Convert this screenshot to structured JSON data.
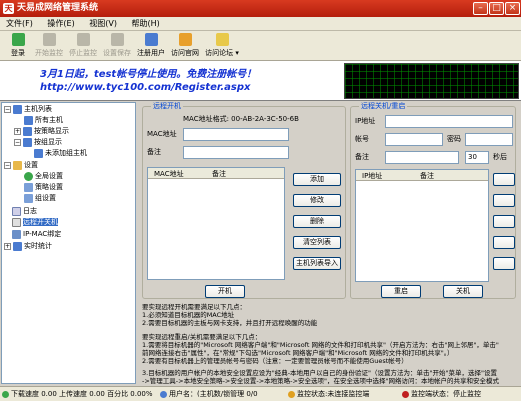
{
  "window": {
    "title": "天易成网络管理系统"
  },
  "menu": [
    {
      "label": "文件(F)"
    },
    {
      "label": "操作(E)"
    },
    {
      "label": "视图(V)"
    },
    {
      "label": "帮助(H)"
    }
  ],
  "toolbar": {
    "login": "登录",
    "start_monitor": "开始监控",
    "stop_monitor": "停止监控",
    "save_settings": "设置保存",
    "register": "注册用户",
    "official_site": "访问官网",
    "forum": "访问论坛"
  },
  "banner": {
    "line1": "3月1日起，test帐号停止使用。免费注册帐号！",
    "line2": "http://www.tyc100.com/Register.aspx"
  },
  "tree": {
    "host_list": "主机列表",
    "all_hosts": "所有主机",
    "by_policy": "按策略显示",
    "by_group": "按组显示",
    "unassigned": "未添加组主机",
    "settings": "设置",
    "global_settings": "全局设置",
    "policy_settings": "策略设置",
    "group_settings": "组设置",
    "log": "日志",
    "remote_power": "远程开关机",
    "ip_mac": "IP-MAC绑定",
    "realtime": "实时统计"
  },
  "boot": {
    "legend": "远程开机",
    "mac_format": "MAC地址格式: 00-AB-2A-3C-50-6B",
    "mac_label": "MAC地址",
    "note_label": "备注",
    "col_mac": "MAC地址",
    "col_note": "备注",
    "add": "添加",
    "edit": "修改",
    "delete": "删除",
    "clear": "清空列表",
    "import": "主机列表导入",
    "power_on": "开机"
  },
  "shutdown": {
    "legend": "远程关机/重启",
    "ip_label": "IP地址",
    "account_label": "帐号",
    "password_label": "密码",
    "note_label": "备注",
    "delay": "30",
    "seconds": "秒后",
    "col_ip": "IP地址",
    "col_note": "备注",
    "restart": "重启",
    "shutdown": "关机"
  },
  "info": {
    "l1": "要实现远程开机需要满足以下几点：",
    "l2": "1.必须知道目标机器的MAC地址",
    "l3": "2.需要目标机器的主板与网卡支持，并且打开远程唤醒的功能",
    "l4": "要实现远程重启/关机需要满足以下几点：",
    "l5": "1.需要将目标机器的\"Microsoft 网络客户端\"和\"Microsoft 网络的文件和打印机共享\"（开启方法为：右击\"网上邻居\"，单击\"",
    "l6": "前网络连接右击\"属性\"，在\"常规\"下勾选\"Microsoft 网络客户端\"和\"Microsoft 网络的文件和打印机共享\"。）",
    "l7": "2.需要有目标机器上的管理员帐号与密码（注意：一定要管理员帐号而不能使用Guest帐号）",
    "l8": "3.目标机器的用户帐户的本地安全设置应设为\"经典-本地用户以自己的身份验证\"（设置方法为：单击\"开始\"菜单，选择\"设置",
    "l9": "->管理工具->本地安全策略->安全设置->本地策略->安全选项\"，在安全选项中选择\"网络访问：本地帐户的共享和安全模式"
  },
  "status": {
    "download": "下载速度 0.00 上传速度 0.00 百分比 0.00%",
    "user": "用户名：(主机数/锁管理 0/0",
    "monitor_status": "监控状态:未连接监控端",
    "run_status": "监控端状态：停止监控"
  }
}
